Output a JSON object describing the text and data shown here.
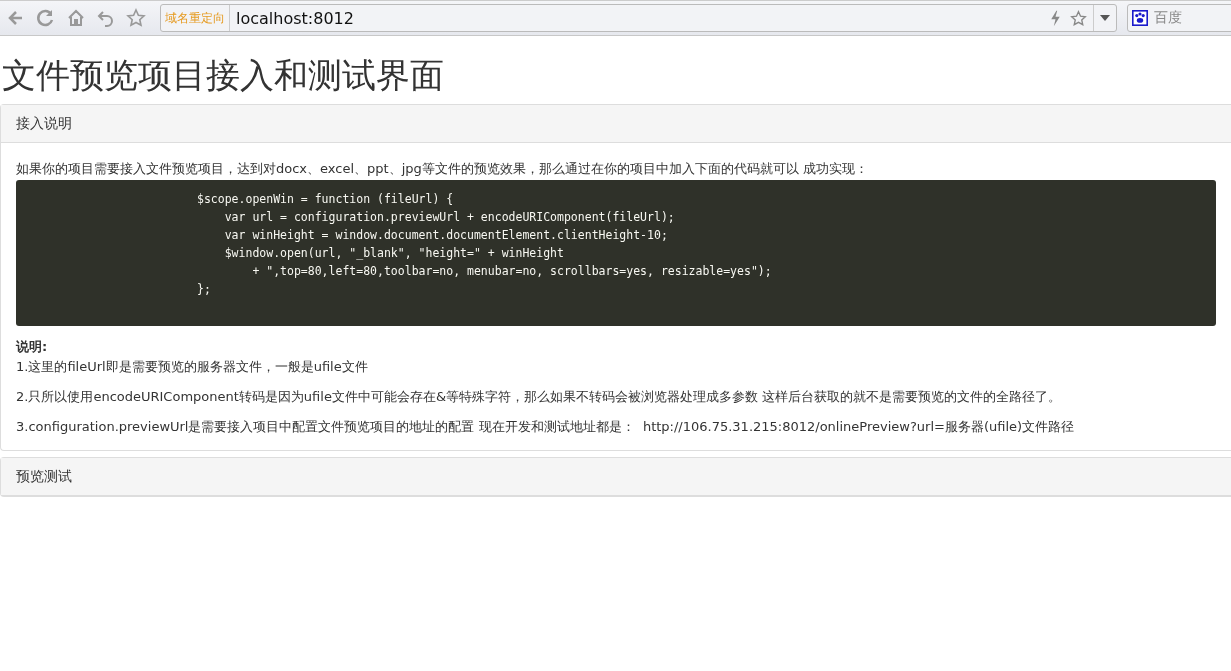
{
  "browser": {
    "redirect_badge": "域名重定向",
    "address": "localhost:8012",
    "search_engine": "百度"
  },
  "page_title": "文件预览项目接入和测试界面",
  "panels": [
    {
      "heading": "接入说明",
      "intro": "如果你的项目需要接入文件预览项目，达到对docx、excel、ppt、jpg等文件的预览效果，那么通过在你的项目中加入下面的代码就可以 成功实现：",
      "code_lines": [
        "$scope.openWin = function (fileUrl) {",
        "    var url = configuration.previewUrl + encodeURIComponent(fileUrl);",
        "    var winHeight = window.document.documentElement.clientHeight-10;",
        "    $window.open(url, \"_blank\", \"height=\" + winHeight",
        "        + \",top=80,left=80,toolbar=no, menubar=no, scrollbars=yes, resizable=yes\");",
        "};"
      ],
      "notes_title": "说明:",
      "notes": [
        {
          "text": "1.这里的fileUrl即是需要预览的服务器文件，一般是ufile文件"
        },
        {
          "text": "2.只所以使用encodeURIComponent转码是因为ufile文件中可能会存在&等特殊字符，那么如果不转码会被浏览器处理成多参数 这样后台获取的就不是需要预览的文件的全路径了。"
        },
        {
          "text": "3.configuration.previewUrl是需要接入项目中配置文件预览项目的地址的配置 现在开发和测试地址都是：",
          "link": "http://106.75.31.215:8012/onlinePreview?url=服务器(ufile)文件路径"
        }
      ]
    },
    {
      "heading": "预览测试"
    }
  ]
}
